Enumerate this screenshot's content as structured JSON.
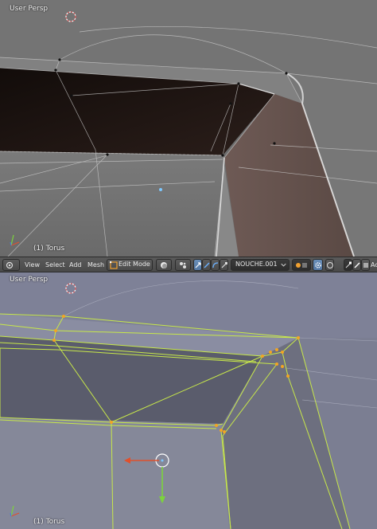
{
  "viewport_top": {
    "view_label": "User Persp",
    "object_label": "(1) Torus"
  },
  "header": {
    "menu": [
      "View",
      "Select",
      "Add",
      "Mesh"
    ],
    "mode": "Edit Mode",
    "object_name": "NOUCHE.001",
    "trailing_text": "Ac"
  },
  "viewport_bottom": {
    "view_label": "User Persp",
    "object_label": "(1) Torus"
  },
  "colors": {
    "solid_gray": "#6d6d6d",
    "edit_blue_gray": "#7c7f94",
    "selected_edge": "#c8e84a",
    "selected_vertex": "#f3a522",
    "cursor_ring": "#e05a5a",
    "gizmo_x": "#e0502c",
    "gizmo_y": "#7cd33d"
  }
}
